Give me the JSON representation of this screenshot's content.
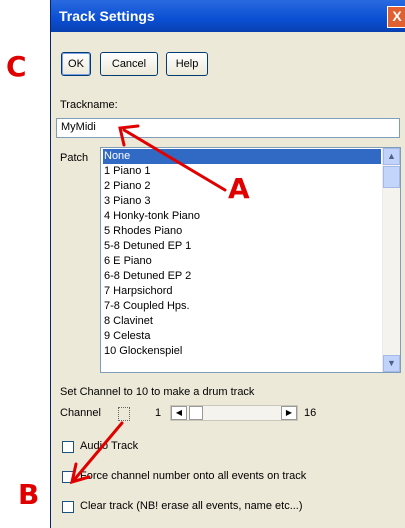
{
  "window": {
    "title": "Track Settings",
    "close_glyph": "X"
  },
  "buttons": {
    "ok": "OK",
    "cancel": "Cancel",
    "help": "Help"
  },
  "trackname": {
    "label": "Trackname:",
    "value": "MyMidi"
  },
  "patch": {
    "label": "Patch",
    "items": [
      "None",
      "1 Piano 1",
      "2 Piano 2",
      "3 Piano 3",
      "4 Honky-tonk Piano",
      "5 Rhodes Piano",
      "5-8 Detuned EP 1",
      "6 E Piano",
      "6-8 Detuned EP 2",
      "7 Harpsichord",
      "7-8 Coupled Hps.",
      "8 Clavinet",
      "9 Celesta",
      "10 Glockenspiel"
    ],
    "selected_index": 0
  },
  "channel": {
    "hint": "Set Channel to 10 to make a drum track",
    "label": "Channel",
    "value": "1",
    "min": "1",
    "max": "16"
  },
  "options": {
    "audio_track": "Audio Track",
    "force_channel": "Force channel number onto all events on track",
    "clear_track": "Clear track (NB! erase all events, name etc...)"
  },
  "annotations": {
    "a": "A",
    "b": "B",
    "c": "C",
    "color": "#e00000"
  }
}
